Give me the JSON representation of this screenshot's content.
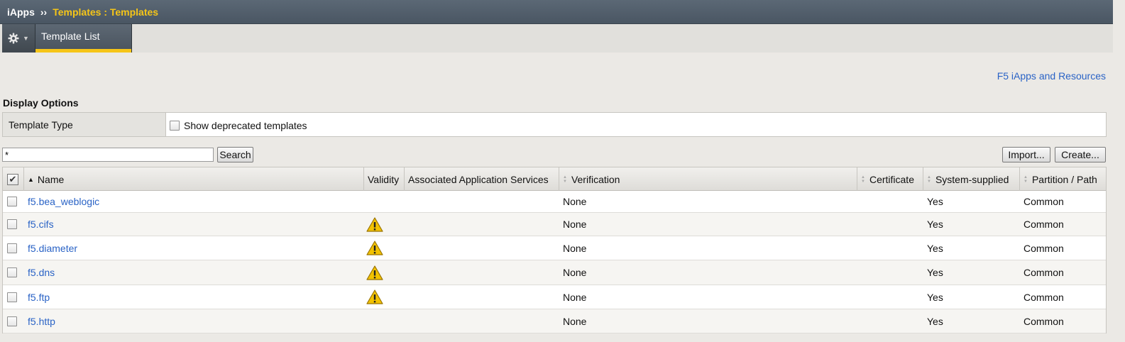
{
  "breadcrumb": {
    "app": "iApps",
    "separator": "››",
    "current": "Templates : Templates"
  },
  "tabs": {
    "gear_icon": "gear-icon",
    "active_tab": "Template List"
  },
  "resources_link": "F5 iApps and Resources",
  "display_options": {
    "title": "Display Options",
    "label": "Template Type",
    "checkbox_label": "Show deprecated templates",
    "checkbox_checked": false
  },
  "search": {
    "value": "*",
    "button": "Search"
  },
  "actions": {
    "import": "Import...",
    "create": "Create..."
  },
  "table": {
    "columns": {
      "name": "Name",
      "validity": "Validity",
      "associated": "Associated Application Services",
      "verification": "Verification",
      "certificate": "Certificate",
      "system_supplied": "System-supplied",
      "partition": "Partition / Path"
    },
    "rows": [
      {
        "name": "f5.bea_weblogic",
        "warning": false,
        "verification": "None",
        "system_supplied": "Yes",
        "partition": "Common"
      },
      {
        "name": "f5.cifs",
        "warning": true,
        "verification": "None",
        "system_supplied": "Yes",
        "partition": "Common"
      },
      {
        "name": "f5.diameter",
        "warning": true,
        "verification": "None",
        "system_supplied": "Yes",
        "partition": "Common"
      },
      {
        "name": "f5.dns",
        "warning": true,
        "verification": "None",
        "system_supplied": "Yes",
        "partition": "Common"
      },
      {
        "name": "f5.ftp",
        "warning": true,
        "verification": "None",
        "system_supplied": "Yes",
        "partition": "Common"
      },
      {
        "name": "f5.http",
        "warning": false,
        "verification": "None",
        "system_supplied": "Yes",
        "partition": "Common"
      }
    ]
  },
  "colors": {
    "title_bar": "#4f5b67",
    "breadcrumb_highlight": "#f5c518",
    "link": "#2a63c6",
    "warning": "#f2c200"
  }
}
